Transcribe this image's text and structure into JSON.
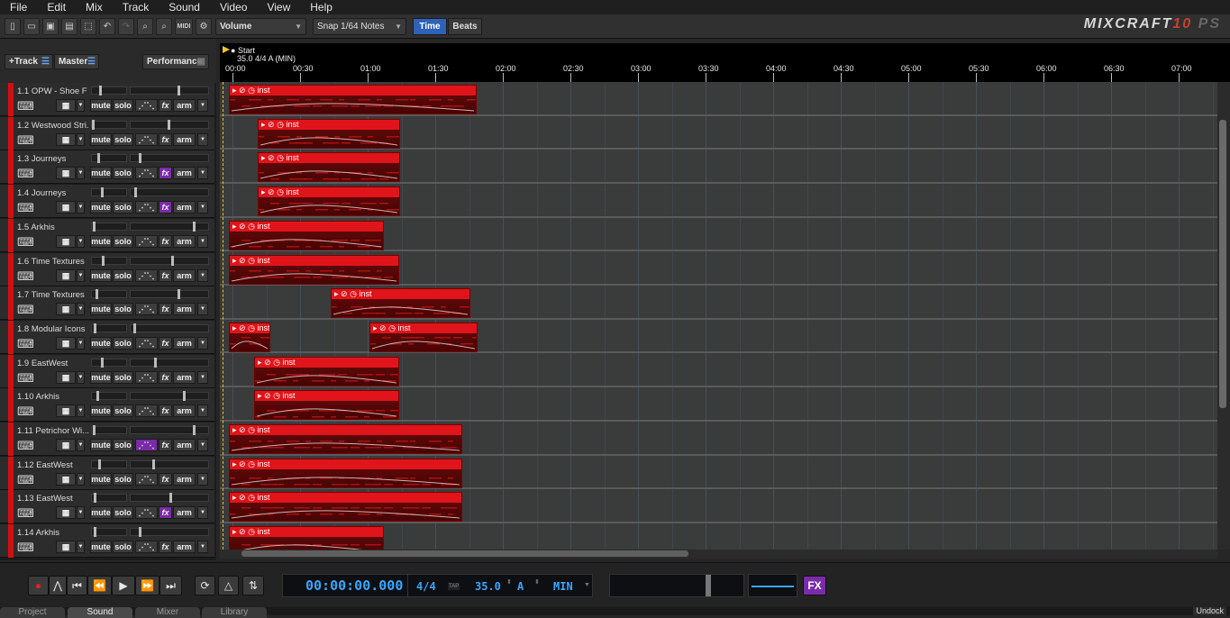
{
  "menu": [
    "File",
    "Edit",
    "Mix",
    "Track",
    "Sound",
    "Video",
    "View",
    "Help"
  ],
  "toolbar": {
    "param_select": "Volume",
    "snap_select": "Snap 1/64 Notes",
    "time_label": "Time",
    "beats_label": "Beats",
    "icons": [
      "new-icon",
      "open-icon",
      "save-as-icon",
      "save-icon",
      "select-icon",
      "undo-icon",
      "redo-icon",
      "zoom-in-icon",
      "zoom-out-icon",
      "midi-icon",
      "settings-icon"
    ],
    "midi_label": "MIDI"
  },
  "logo": {
    "main": "MIXCRAFT",
    "version": "10",
    "edition": "PS"
  },
  "track_header": {
    "add_track": "+Track",
    "master": "Master",
    "performance": "Performance"
  },
  "ruler": {
    "start_label": "Start",
    "tempo_label": "35.0 4/4 A (MIN)",
    "ticks": [
      "00:00",
      "00:30",
      "01:00",
      "01:30",
      "02:00",
      "02:30",
      "03:00",
      "03:30",
      "04:00",
      "04:30",
      "05:00",
      "05:30",
      "06:00",
      "06:30",
      "07:00"
    ]
  },
  "track_buttons": {
    "mute": "mute",
    "solo": "solo",
    "fx": "fx",
    "arm": "arm"
  },
  "clip_label": "inst",
  "tracks": [
    {
      "name": "1.1 OPW - Shoe F",
      "fx_on": false,
      "auto_on": false
    },
    {
      "name": "1.2 Westwood Stri...",
      "fx_on": false,
      "auto_on": false
    },
    {
      "name": "1.3 Journeys",
      "fx_on": true,
      "auto_on": false
    },
    {
      "name": "1.4 Journeys",
      "fx_on": true,
      "auto_on": false
    },
    {
      "name": "1.5 Arkhis",
      "fx_on": false,
      "auto_on": false
    },
    {
      "name": "1.6 Time Textures",
      "fx_on": false,
      "auto_on": false
    },
    {
      "name": "1.7 Time Textures",
      "fx_on": false,
      "auto_on": false
    },
    {
      "name": "1.8 Modular Icons",
      "fx_on": false,
      "auto_on": false
    },
    {
      "name": "1.9 EastWest",
      "fx_on": false,
      "auto_on": false
    },
    {
      "name": "1.10 Arkhis",
      "fx_on": false,
      "auto_on": false
    },
    {
      "name": "1.11 Petrichor Wi...",
      "fx_on": false,
      "auto_on": true
    },
    {
      "name": "1.12 EastWest",
      "fx_on": false,
      "auto_on": false
    },
    {
      "name": "1.13 EastWest",
      "fx_on": true,
      "auto_on": false
    },
    {
      "name": "1.14 Arkhis",
      "fx_on": false,
      "auto_on": false
    }
  ],
  "transport": {
    "time": "00:00:00.000",
    "signature": "4/4",
    "tap": "TAP",
    "tempo": "35.0",
    "key": "A",
    "mode": "MIN",
    "fx": "FX"
  },
  "bottom_tabs": [
    "Project",
    "Sound",
    "Mixer",
    "Library"
  ],
  "undock": "Undock",
  "colors": {
    "clip_header": "#e0141a",
    "track_strip": "#d01010",
    "lcd_text": "#37a7ff",
    "fx_active": "#7a2ba8",
    "time_active": "#2d62b8"
  }
}
